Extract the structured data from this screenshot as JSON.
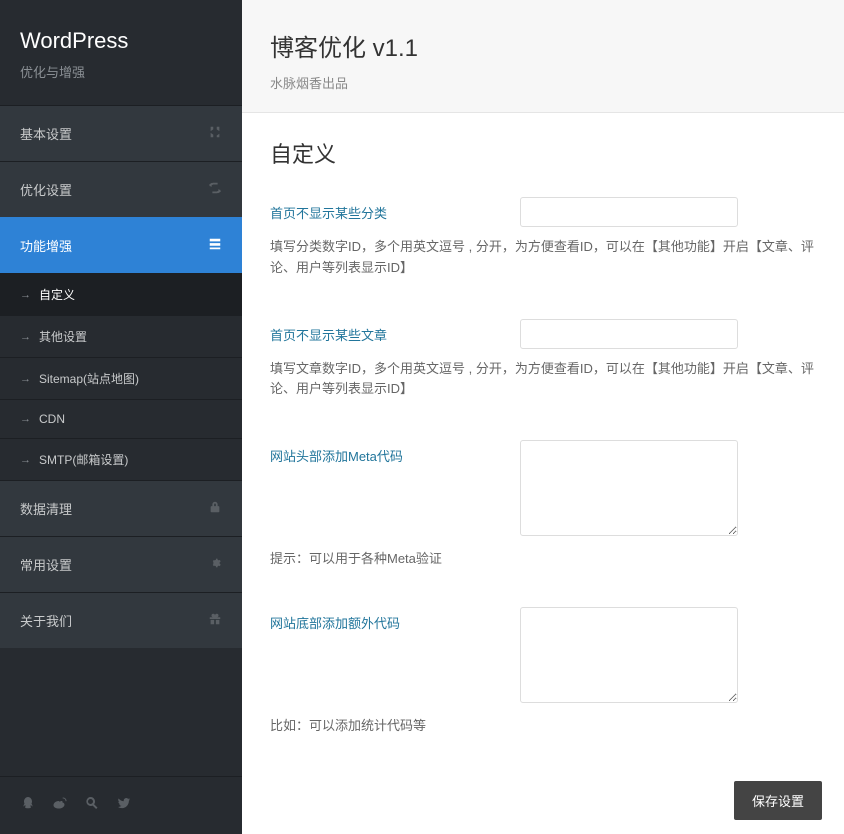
{
  "sidebar": {
    "title": "WordPress",
    "subtitle": "优化与增强",
    "nav": [
      {
        "label": "基本设置",
        "icon": "switch"
      },
      {
        "label": "优化设置",
        "icon": "repeat"
      },
      {
        "label": "功能增强",
        "icon": "layout",
        "active": true
      },
      {
        "label": "数据清理",
        "icon": "lock"
      },
      {
        "label": "常用设置",
        "icon": "gear"
      },
      {
        "label": "关于我们",
        "icon": "gift"
      }
    ],
    "subnav": [
      {
        "label": "自定义",
        "active": true
      },
      {
        "label": "其他设置"
      },
      {
        "label": "Sitemap(站点地图)"
      },
      {
        "label": "CDN"
      },
      {
        "label": "SMTP(邮箱设置)"
      }
    ]
  },
  "header": {
    "title": "博客优化 v1.1",
    "subtitle": "水脉烟香出品"
  },
  "content": {
    "section_title": "自定义",
    "fields": {
      "exclude_categories": {
        "label": "首页不显示某些分类",
        "help": "填写分类数字ID，多个用英文逗号 , 分开，为方便查看ID，可以在【其他功能】开启【文章、评论、用户等列表显示ID】"
      },
      "exclude_posts": {
        "label": "首页不显示某些文章",
        "help": "填写文章数字ID，多个用英文逗号 , 分开，为方便查看ID，可以在【其他功能】开启【文章、评论、用户等列表显示ID】"
      },
      "meta_code": {
        "label": "网站头部添加Meta代码",
        "hint": "提示：可以用于各种Meta验证"
      },
      "footer_code": {
        "label": "网站底部添加额外代码",
        "hint": "比如：可以添加统计代码等"
      }
    }
  },
  "actions": {
    "save": "保存设置"
  }
}
